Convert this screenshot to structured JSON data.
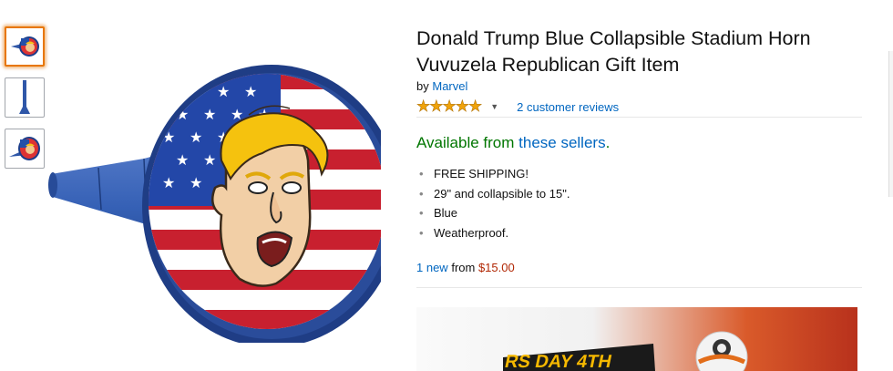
{
  "product": {
    "title": "Donald Trump Blue Collapsible Stadium Horn Vuvuzela Republican Gift Item",
    "by_prefix": "by",
    "brand": "Marvel",
    "stars_icon": "★★★★★",
    "caret_icon": "▼",
    "rating_fraction": 0.9,
    "reviews": "2 customer reviews"
  },
  "availability": {
    "prefix": "Available from",
    "link": "these sellers",
    "suffix": "."
  },
  "bullets": [
    "FREE SHIPPING!",
    "29\" and collapsible to 15\".",
    "Blue",
    "Weatherproof."
  ],
  "offers": {
    "count_link": "1 new",
    "from": "from",
    "price": "$15.00"
  },
  "ad": {
    "text": "RS DAY 4TH"
  },
  "colors": {
    "link": "#0066c0",
    "availability": "#007600",
    "price": "#b12704",
    "selected_thumb": "#e77600"
  }
}
